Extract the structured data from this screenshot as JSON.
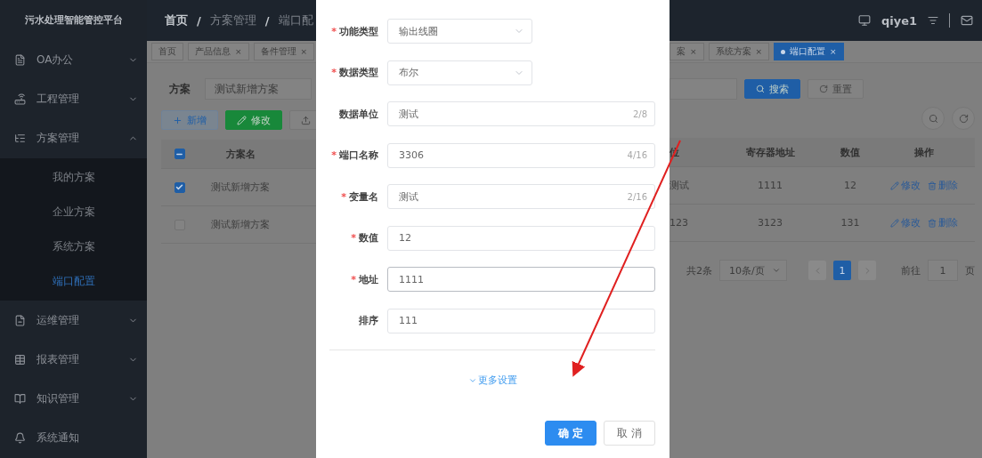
{
  "sidebar": {
    "title": "污水处理智能管控平台",
    "items": [
      {
        "label": "OA办公",
        "expanded": false
      },
      {
        "label": "工程管理",
        "expanded": false
      },
      {
        "label": "方案管理",
        "expanded": true,
        "children": [
          {
            "label": "我的方案",
            "selected": false
          },
          {
            "label": "企业方案",
            "selected": false
          },
          {
            "label": "系统方案",
            "selected": false
          },
          {
            "label": "端口配置",
            "selected": true
          }
        ]
      },
      {
        "label": "运维管理",
        "expanded": false
      },
      {
        "label": "报表管理",
        "expanded": false
      },
      {
        "label": "知识管理",
        "expanded": false
      },
      {
        "label": "系统通知"
      }
    ]
  },
  "header": {
    "breadcrumb": [
      "首页",
      "方案管理",
      "端口配"
    ],
    "separator": "/",
    "user": "qiye1"
  },
  "tabs_left": [
    {
      "label": "首页",
      "selected": false
    },
    {
      "label": "产品信息",
      "close": "×",
      "selected": false
    },
    {
      "label": "备件管理",
      "close": "×",
      "selected": false
    }
  ],
  "tabs_right": [
    {
      "label": "案",
      "close": "×",
      "selected": false
    },
    {
      "label": "系统方案",
      "close": "×",
      "selected": false
    },
    {
      "label": "端口配置",
      "close": "×",
      "selected": true
    }
  ],
  "search": {
    "label": "方案",
    "value": "测试新增方案",
    "search_button": "搜索",
    "reset_button": "重置"
  },
  "toolbar": [
    {
      "label": "新增",
      "kind": "add"
    },
    {
      "label": "修改",
      "kind": "edit"
    },
    {
      "kind": "export"
    }
  ],
  "table_left": {
    "columns": [
      "方案名"
    ],
    "header_checked": true,
    "header_indeterminate": true,
    "rows": [
      {
        "checked": true,
        "cells": [
          "测试新增方案"
        ]
      },
      {
        "checked": false,
        "cells": [
          "测试新增方案"
        ]
      }
    ]
  },
  "table_right": {
    "columns": [
      "位",
      "寄存器地址",
      "数值",
      "操作"
    ],
    "rows": [
      {
        "cells": [
          "测试",
          "1111",
          "12"
        ],
        "actions": [
          "修改",
          "删除"
        ]
      },
      {
        "cells": [
          "123",
          "3123",
          "131"
        ],
        "actions": [
          "修改",
          "删除"
        ]
      }
    ]
  },
  "pagination": {
    "total": "共2条",
    "page_size": "10条/页",
    "current": "1",
    "goto_label": "前往",
    "goto_value": "1",
    "page_suffix": "页"
  },
  "dialog": {
    "fields": [
      {
        "label": "功能类型",
        "required_mark": "*",
        "kind": "select",
        "value": "输出线圈",
        "focused": false
      },
      {
        "label": "数据类型",
        "required_mark": "*",
        "kind": "select",
        "value": "布尔",
        "focused": false
      },
      {
        "label": "数据单位",
        "kind": "input",
        "value": "测试",
        "counter": "2/8",
        "focused": false
      },
      {
        "label": "端口名称",
        "required_mark": "*",
        "kind": "input",
        "value": "3306",
        "counter": "4/16",
        "focused": false
      },
      {
        "label": "变量名",
        "required_mark": "*",
        "kind": "input",
        "value": "测试",
        "counter": "2/16",
        "focused": false
      },
      {
        "label": "数值",
        "required_mark": "*",
        "kind": "input",
        "value": "12",
        "focused": false
      },
      {
        "label": "地址",
        "required_mark": "*",
        "kind": "input",
        "value": "1111",
        "focused": true
      },
      {
        "label": "排序",
        "kind": "input",
        "value": "111",
        "focused": false
      }
    ],
    "more_link": "更多设置",
    "confirm": "确 定",
    "cancel": "取 消"
  }
}
